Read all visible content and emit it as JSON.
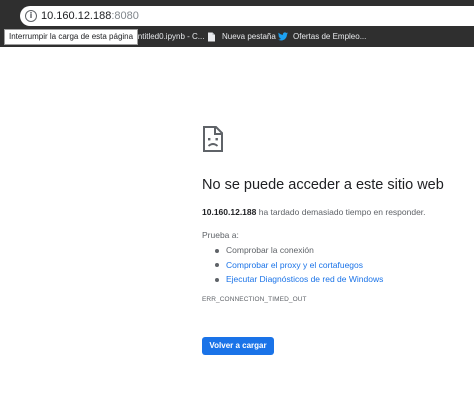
{
  "browser": {
    "url_host": "10.160.12.188",
    "url_port": ":8080",
    "tooltip": "Interrumpir la carga de esta página",
    "bookmarks": [
      {
        "label": "Untitled0.ipynb - C...",
        "icon": "jupyter-icon"
      },
      {
        "label": "Nueva pestaña",
        "icon": "page-icon"
      },
      {
        "label": "Ofertas de Empleo...",
        "icon": "twitter-icon"
      }
    ]
  },
  "error_page": {
    "icon": "sad-page-icon",
    "title": "No se puede acceder a este sitio web",
    "host": "10.160.12.188",
    "detail_suffix": " ha tardado demasiado tiempo en responder.",
    "try_label": "Prueba a:",
    "suggestions": [
      {
        "text": "Comprobar la conexión",
        "link": false
      },
      {
        "text": "Comprobar el proxy y el cortafuegos",
        "link": true
      },
      {
        "text": "Ejecutar Diagnósticos de red de Windows",
        "link": true
      }
    ],
    "error_code": "ERR_CONNECTION_TIMED_OUT",
    "reload_label": "Volver a cargar"
  },
  "colors": {
    "chrome_bg": "#2f2f2f",
    "link": "#1a73e8",
    "button_bg": "#1a73e8"
  }
}
